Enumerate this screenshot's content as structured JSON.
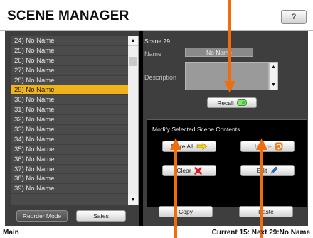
{
  "header": {
    "title": "SCENE MANAGER",
    "help_label": "?"
  },
  "scene_list": {
    "items": [
      "24) No Name",
      "25) No Name",
      "26) No Name",
      "27) No Name",
      "28) No Name",
      "29) No Name",
      "30) No Name",
      "31) No Name",
      "32) No Name",
      "33) No Name",
      "34) No Name",
      "35) No Name",
      "36) No Name",
      "37) No Name",
      "38) No Name",
      "39) No Name"
    ],
    "selected_index": 5,
    "selected_color": "#f0b31c"
  },
  "left_buttons": {
    "reorder_label": "Reorder Mode",
    "safes_label": "Safes"
  },
  "scene_details": {
    "scene_id": "Scene 29",
    "name_label": "Name",
    "name_value": "No Name",
    "description_label": "Description",
    "recall_label": "Recall"
  },
  "modify": {
    "title": "Modify Selected Scene Contents",
    "store_all_label": "Store All",
    "update_label": "Update",
    "clear_label": "Clear",
    "edit_label": "Edit"
  },
  "clipboard": {
    "copy_label": "Copy",
    "paste_label": "Paste"
  },
  "footer": {
    "left": "Main",
    "right": "Current 15:   Next 29:No Name"
  },
  "icons": {
    "recall": "green-led-icon",
    "store_all": "yellow-arrow-icon",
    "update": "orange-refresh-icon",
    "clear": "red-x-icon",
    "edit": "blue-pencil-icon"
  },
  "colors": {
    "accent_orange": "#f06d0d",
    "selected_row": "#f0b31c"
  }
}
